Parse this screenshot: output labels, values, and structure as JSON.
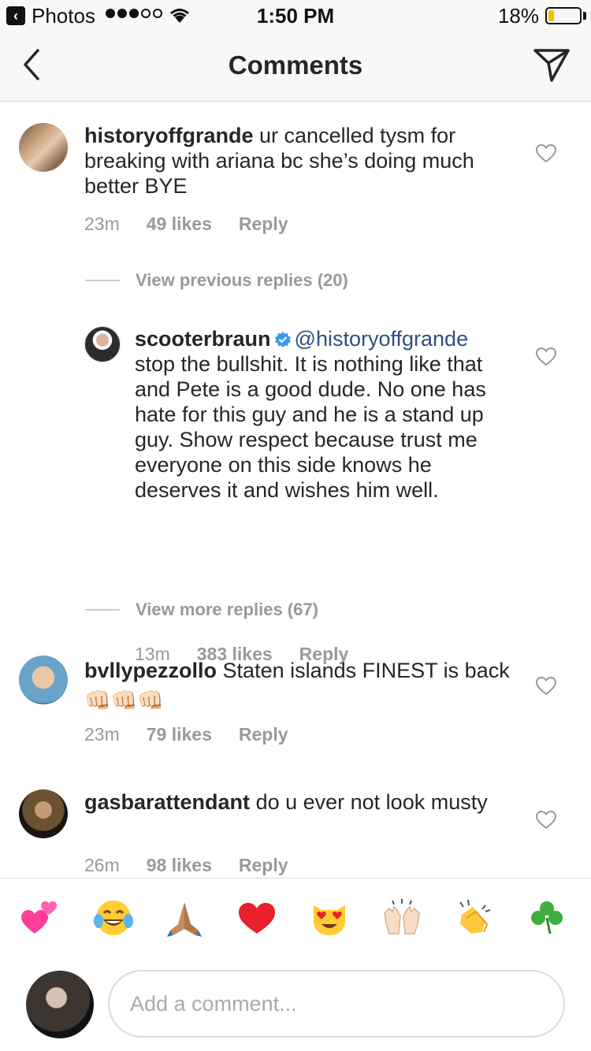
{
  "status_bar": {
    "back_app": "Photos",
    "time": "1:50 PM",
    "battery": "18%",
    "battery_level": 0.18
  },
  "nav": {
    "title": "Comments"
  },
  "comments": [
    {
      "user": "historyoffgrande",
      "text": "ur cancelled tysm for breaking with ariana bc she’s doing much better BYE",
      "time": "23m",
      "likes": "49 likes",
      "reply": "Reply"
    },
    {
      "user": "scooterbraun",
      "mention": "@historyoffgrande",
      "text": "stop the bullshit. It is nothing like that and Pete is a good dude. No one has hate for this guy and he is a stand up guy. Show respect because trust me everyone on this side knows he deserves it and wishes him well.",
      "time": "13m",
      "likes": "383 likes",
      "reply": "Reply"
    },
    {
      "user": "bvllypezzollo",
      "text": "Staten islands FINEST is back 👊🏻👊🏻👊🏻",
      "time": "23m",
      "likes": "79 likes",
      "reply": "Reply"
    },
    {
      "user": "gasbarattendant",
      "text": "do u ever not look musty",
      "time": "26m",
      "likes": "98 likes",
      "reply": "Reply"
    }
  ],
  "view_previous": "View previous replies (20)",
  "view_more": "View more replies (67)",
  "emoji_bar": [
    "💕",
    "😂",
    "🙏🏽",
    "❤️",
    "😻",
    "🙌🏻",
    "👏",
    "☘️"
  ],
  "composer": {
    "placeholder": "Add a comment..."
  }
}
